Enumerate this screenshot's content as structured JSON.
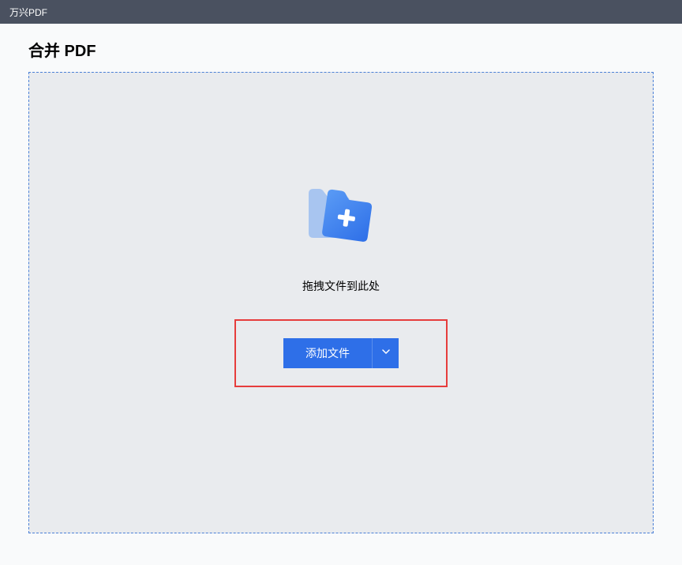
{
  "titlebar": {
    "app_name": "万兴PDF"
  },
  "page": {
    "title": "合并 PDF"
  },
  "dropzone": {
    "drag_text": "拖拽文件到此处",
    "add_file_label": "添加文件"
  }
}
